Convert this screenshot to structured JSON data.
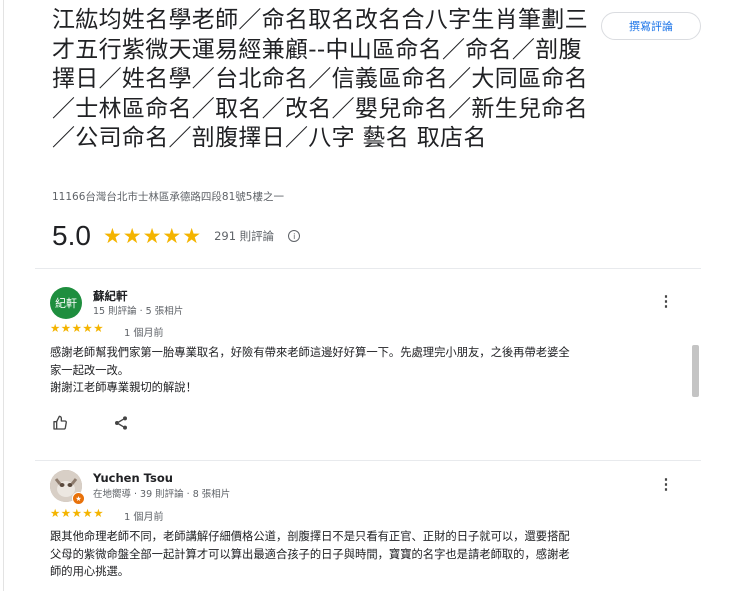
{
  "place": {
    "title": "江紘均姓名學老師／命名取名改名合八字生肖筆劃三才五行紫微天運易經兼顧--中山區命名／命名／剖腹擇日／姓名學／台北命名／信義區命名／大同區命名／士林區命名／取名／改名／嬰兒命名／新生兒命名／公司命名／剖腹擇日／八字 藝名 取店名",
    "write_review_label": "撰寫評論",
    "address": "11166台灣台北市士林區承德路四段81號5樓之一",
    "rating": "5.0",
    "stars": "★★★★★",
    "review_count": "291 則評論",
    "info_icon": "ⓘ"
  },
  "reviews": [
    {
      "avatar_text": "紀軒",
      "avatar_color": "#1e8e3e",
      "name": "蘇紀軒",
      "meta": "15 則評論 · 5 張相片",
      "stars": "★★★★★",
      "date": "1 個月前",
      "text_lines": [
        "感謝老師幫我們家第一胎專業取名，好險有帶來老師這邊好好算一下。先處理完小朋友，之後再帶老婆全",
        "家一起改一改。",
        "謝謝江老師專業親切的解說！"
      ],
      "more_icon": "⋮"
    },
    {
      "avatar_text": "",
      "avatar_color": "#b9a89a",
      "name": "Yuchen Tsou",
      "meta": "在地嚮導 · 39 則評論 · 8 張相片",
      "stars": "★★★★★",
      "date": "1 個月前",
      "text_lines": [
        "跟其他命理老師不同，老師講解仔細價格公道，剖腹擇日不是只看有正官、正財的日子就可以，還要搭配",
        "父母的紫微命盤全部一起計算才可以算出最適合孩子的日子與時間，寶寶的名字也是請老師取的，感謝老",
        "師的用心挑選。"
      ],
      "more_icon": "⋮"
    }
  ],
  "colors": {
    "star": "#f4b400",
    "accent": "#1a73e8",
    "guide_badge": "#e8710a"
  }
}
